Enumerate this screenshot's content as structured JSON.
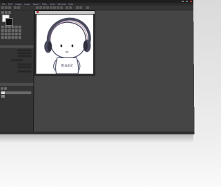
{
  "window": {
    "title": ""
  },
  "menu": [
    "File",
    "Edit",
    "Image",
    "Layer",
    "Select",
    "Filter",
    "View",
    "Window",
    "Help"
  ],
  "left_panel": {
    "section_label": "",
    "layer_header": "",
    "properties": [
      {
        "label": "",
        "value": ""
      },
      {
        "label": "",
        "value": ""
      },
      {
        "label": "",
        "value": ""
      },
      {
        "label": "",
        "value": ""
      },
      {
        "label": "",
        "value": ""
      },
      {
        "label": "",
        "value": ""
      }
    ],
    "field_label": "",
    "layers": [
      {
        "name": "",
        "selected": true
      },
      {
        "name": "",
        "selected": false
      }
    ]
  },
  "document": {
    "title": "",
    "artwork_text": "music"
  },
  "status": {
    "text": ""
  },
  "colors": {
    "workspace": "#454545",
    "panel": "#343434",
    "headphone": "#4a4a5e",
    "outline": "#3a3f58"
  }
}
